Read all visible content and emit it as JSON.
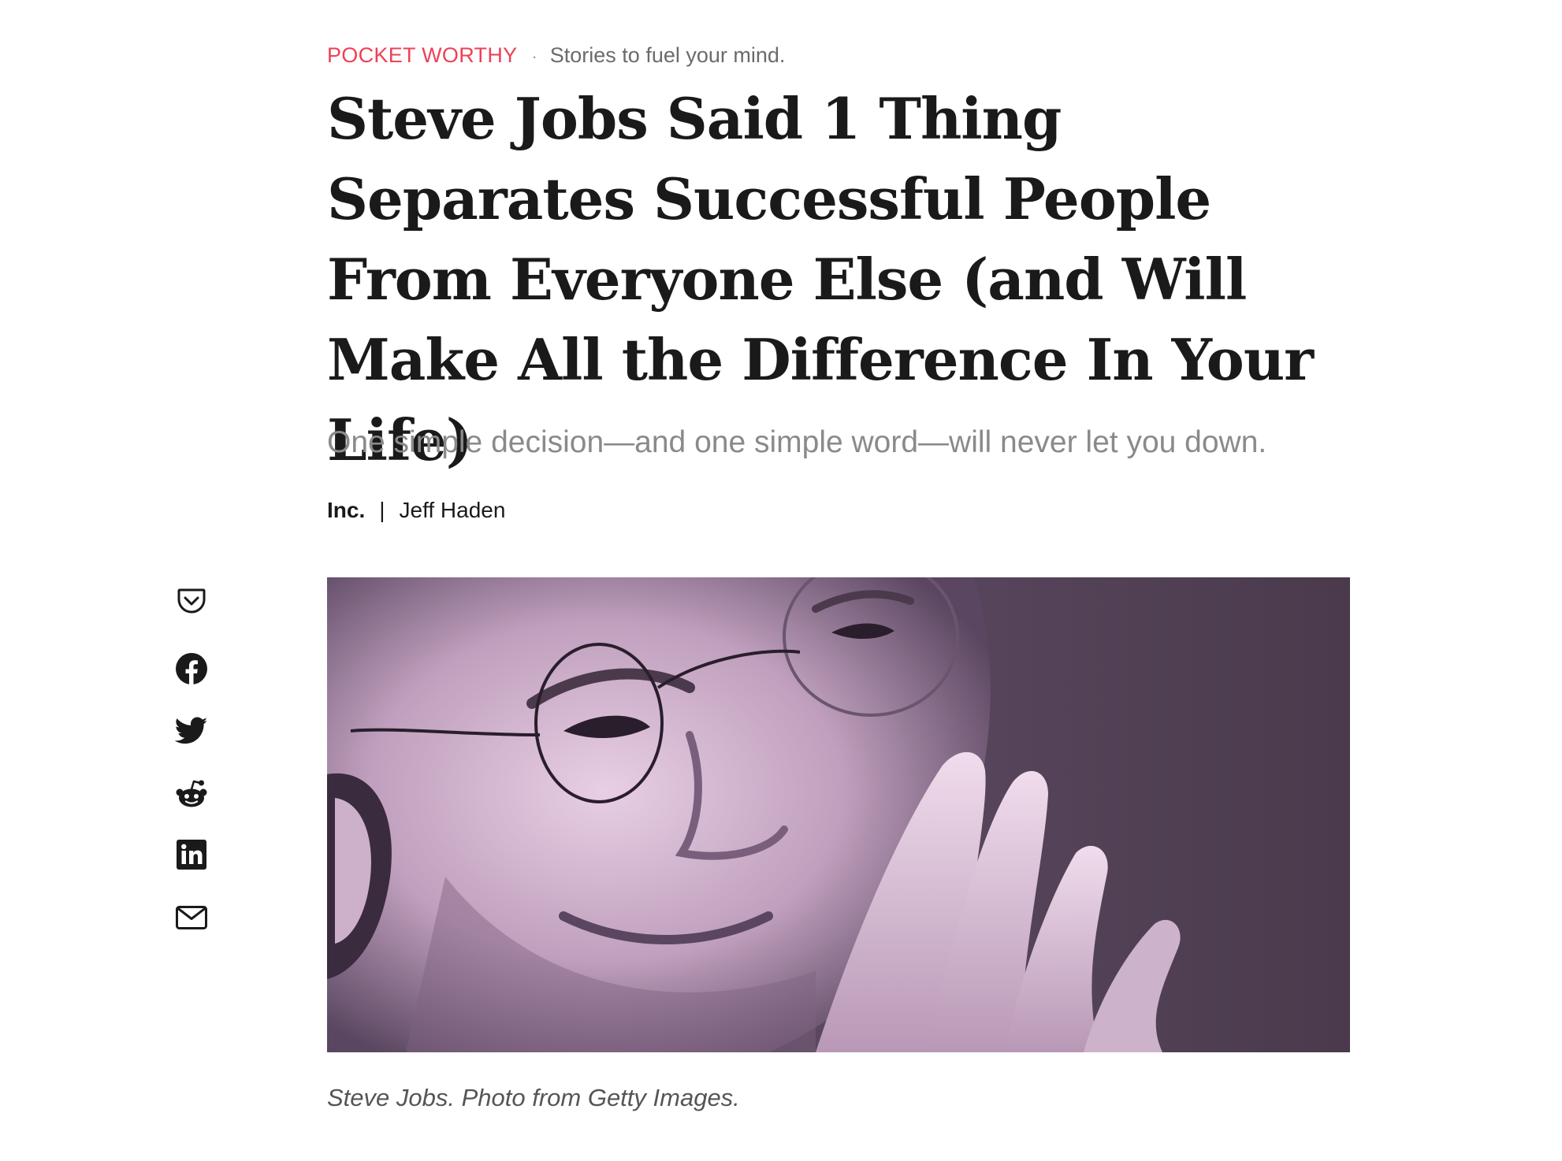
{
  "header": {
    "brand": "POCKET WORTHY",
    "separator": "·",
    "tagline": "Stories to fuel your mind."
  },
  "article": {
    "title": "Steve Jobs Said 1 Thing Separates Successful People From Everyone Else (and Will Make All the Difference In Your Life)",
    "subtitle": "One simple decision—and one simple word—will never let you down.",
    "publisher": "Inc.",
    "byline_divider": "|",
    "author": "Jeff Haden",
    "image_caption": "Steve Jobs. Photo from Getty Images."
  },
  "share": {
    "items": [
      {
        "name": "pocket-icon"
      },
      {
        "name": "facebook-icon"
      },
      {
        "name": "twitter-icon"
      },
      {
        "name": "reddit-icon"
      },
      {
        "name": "linkedin-icon"
      },
      {
        "name": "email-icon"
      }
    ]
  },
  "colors": {
    "brand": "#ef4056",
    "title": "#1a1a1a",
    "subtitle": "#8a8a8a",
    "image_tint": "#d9b8d6"
  }
}
